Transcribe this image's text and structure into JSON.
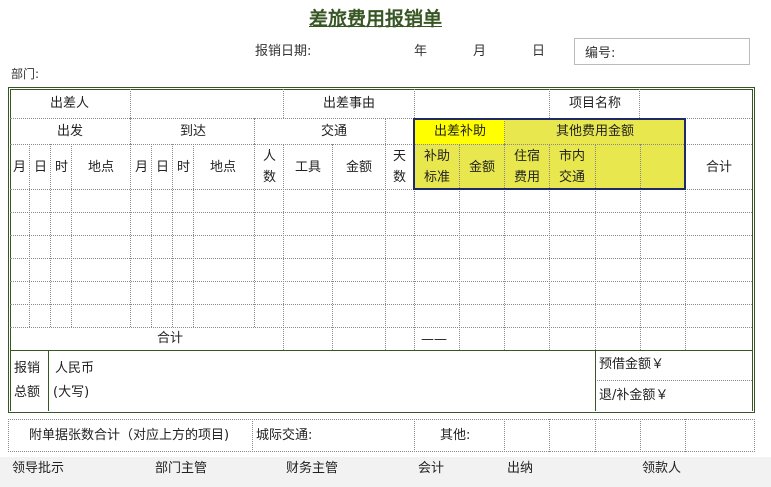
{
  "title": "差旅费用报销单",
  "header": {
    "date_label": "报销日期:",
    "year": "年",
    "month": "月",
    "day": "日",
    "number_label": "编号:",
    "dept_label": "部门:"
  },
  "row1": {
    "traveler": "出差人",
    "reason": "出差事由",
    "project": "项目名称"
  },
  "row2": {
    "depart": "出发",
    "arrive": "到达",
    "transport": "交通",
    "subsidy": "出差补助",
    "other_fees": "其他费用金额"
  },
  "row3": {
    "month": "月",
    "day": "日",
    "time": "时",
    "place": "地点",
    "persons_1": "人",
    "persons_2": "数",
    "tool": "工具",
    "amount": "金额",
    "days_1": "天",
    "days_2": "数",
    "subsidy_std_1": "补助",
    "subsidy_std_2": "标准",
    "subsidy_amount": "金额",
    "lodging_1": "住宿",
    "lodging_2": "费用",
    "city_1": "市内",
    "city_2": "交通",
    "total": "合计"
  },
  "totals_row": {
    "label": "合计",
    "dash": "——"
  },
  "reimburse": {
    "label_1": "报销",
    "label_2": "总额",
    "rmb": "人民币",
    "uppercase": "(大写)",
    "advance": "预借金额￥",
    "refund": "退/补金额￥"
  },
  "attachments": {
    "label": "附单据张数合计（对应上方的项目)",
    "city_transport": "城际交通:",
    "other": "其他:"
  },
  "footer": {
    "leader": "领导批示",
    "dept_head": "部门主管",
    "finance_head": "财务主管",
    "accounting": "会计",
    "cashier": "出纳",
    "payee": "领款人"
  },
  "colors": {
    "title": "#375623",
    "highlight": "#e8e84e",
    "subsidy_header": "#ffff00",
    "border": "#375623"
  }
}
